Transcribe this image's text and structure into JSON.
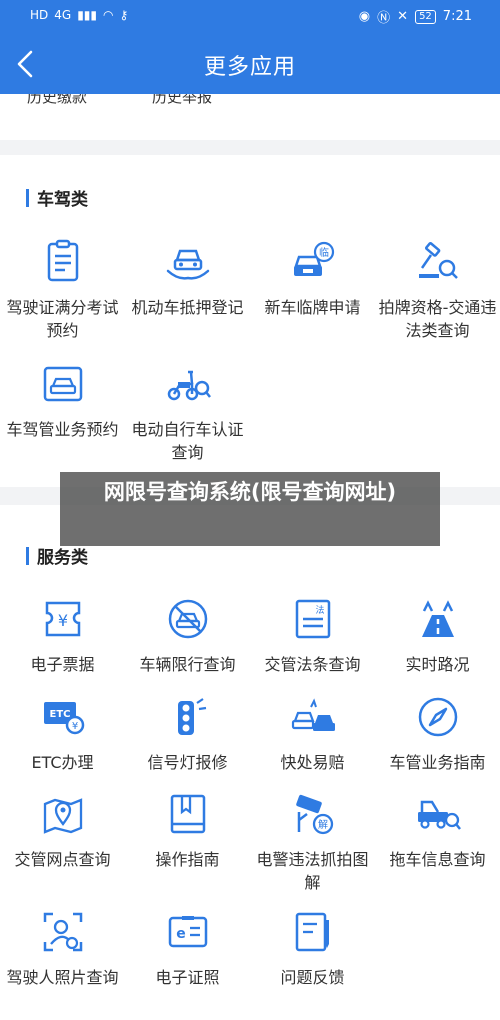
{
  "status_bar": {
    "carrier": "HD",
    "network": "4G",
    "battery": "52",
    "time": "7:21"
  },
  "header": {
    "title": "更多应用"
  },
  "previous_section": {
    "items": [
      "历史缴款",
      "历史举报"
    ]
  },
  "sections": [
    {
      "title": "车驾类",
      "items": [
        {
          "label": "驾驶证满分考试预约",
          "icon": "license-clipboard-icon"
        },
        {
          "label": "机动车抵押登记",
          "icon": "car-in-hand-icon"
        },
        {
          "label": "新车临牌申请",
          "icon": "car-temporary-plate-icon"
        },
        {
          "label": "拍牌资格-交通违法类查询",
          "icon": "plate-auction-search-icon"
        },
        {
          "label": "车驾管业务预约",
          "icon": "car-id-card-icon"
        },
        {
          "label": "电动自行车认证查询",
          "icon": "e-bike-search-icon"
        }
      ]
    },
    {
      "title": "服务类",
      "items": [
        {
          "label": "电子票据",
          "icon": "e-ticket-icon"
        },
        {
          "label": "车辆限行查询",
          "icon": "car-restricted-icon"
        },
        {
          "label": "交管法条查询",
          "icon": "law-document-icon"
        },
        {
          "label": "实时路况",
          "icon": "road-traffic-icon"
        },
        {
          "label": "ETC办理",
          "icon": "etc-card-icon"
        },
        {
          "label": "信号灯报修",
          "icon": "traffic-light-icon"
        },
        {
          "label": "快处易赔",
          "icon": "car-accident-icon"
        },
        {
          "label": "车管业务指南",
          "icon": "compass-icon"
        },
        {
          "label": "交管网点查询",
          "icon": "map-location-icon"
        },
        {
          "label": "操作指南",
          "icon": "book-icon"
        },
        {
          "label": "电警违法抓拍图解",
          "icon": "camera-capture-icon"
        },
        {
          "label": "拖车信息查询",
          "icon": "tow-truck-search-icon"
        },
        {
          "label": "驾驶人照片查询",
          "icon": "driver-photo-icon"
        },
        {
          "label": "电子证照",
          "icon": "e-license-icon"
        },
        {
          "label": "问题反馈",
          "icon": "feedback-icon"
        }
      ]
    }
  ],
  "overlay": {
    "text": "网限号查询系统(限号查询网址)"
  },
  "colors": {
    "brand": "#2f7be2",
    "icon_blue": "#2f7be2",
    "background": "#f2f3f5"
  }
}
